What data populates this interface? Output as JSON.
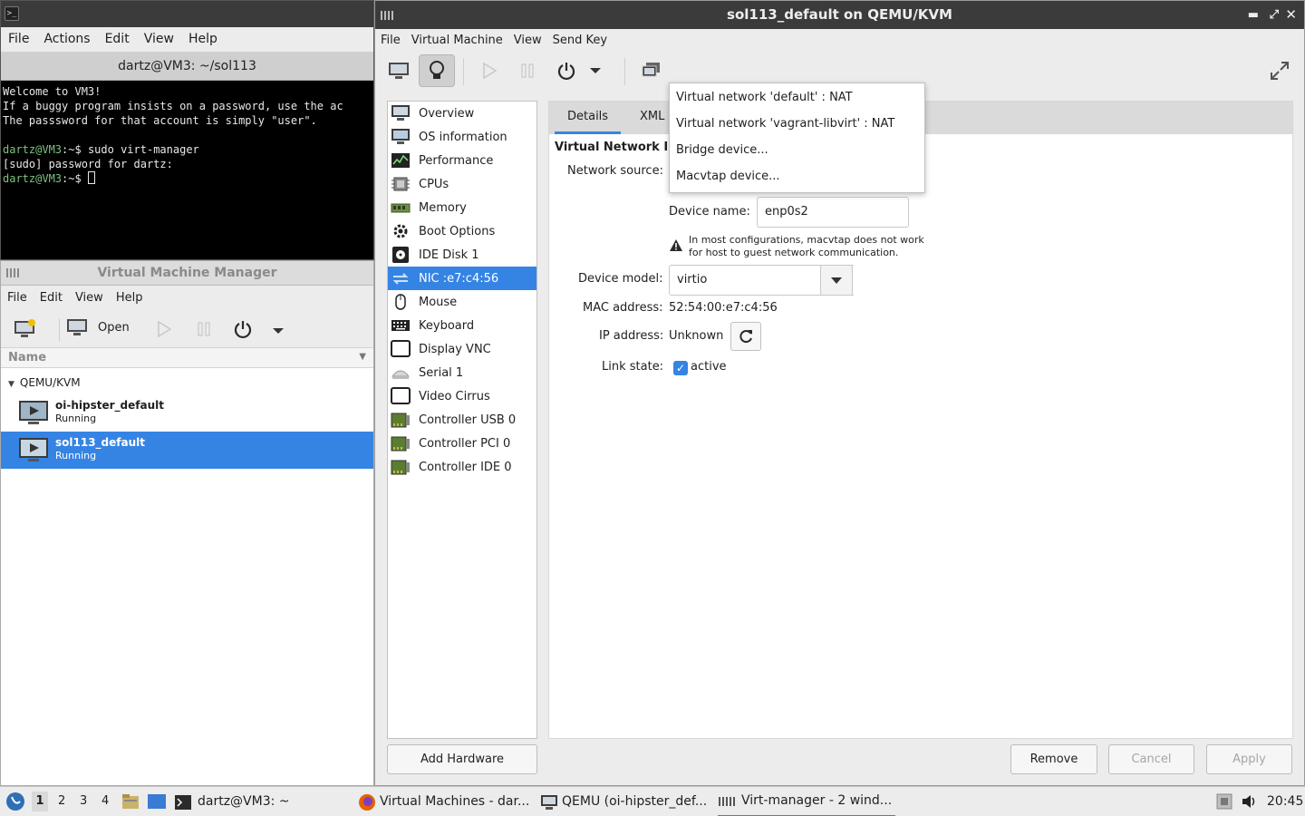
{
  "terminal": {
    "menu": [
      "File",
      "Actions",
      "Edit",
      "View",
      "Help"
    ],
    "tab_title": "dartz@VM3: ~/sol113",
    "line1": "Welcome to VM3!",
    "line2": "If a buggy program insists on a password, use the ac",
    "line3": "The passsword for that account is simply \"user\".",
    "prompt_user": "dartz@VM3",
    "prompt_path": ":~$",
    "command": " sudo virt-manager",
    "sudo_line": "[sudo] password for dartz:"
  },
  "vmm": {
    "title": "Virtual Machine Manager",
    "menu": [
      "File",
      "Edit",
      "View",
      "Help"
    ],
    "open_label": "Open",
    "column_name": "Name",
    "group": "QEMU/KVM",
    "vms": [
      {
        "name": "oi-hipster_default",
        "state": "Running"
      },
      {
        "name": "sol113_default",
        "state": "Running"
      }
    ]
  },
  "details": {
    "title": "sol113_default on QEMU/KVM",
    "menu": [
      "File",
      "Virtual Machine",
      "View",
      "Send Key"
    ],
    "hardware": [
      "Overview",
      "OS information",
      "Performance",
      "CPUs",
      "Memory",
      "Boot Options",
      "IDE Disk 1",
      "NIC :e7:c4:56",
      "Mouse",
      "Keyboard",
      "Display VNC",
      "Serial 1",
      "Video Cirrus",
      "Controller USB 0",
      "Controller PCI 0",
      "Controller IDE 0"
    ],
    "add_hardware": "Add Hardware",
    "tabs": [
      "Details",
      "XML"
    ],
    "section_title": "Virtual Network I",
    "network_source_label": "Network source:",
    "device_name_label": "Device name:",
    "device_name_value": "enp0s2",
    "warning_line1": "In most configurations, macvtap does not work",
    "warning_line2": "for host to guest network communication.",
    "device_model_label": "Device model:",
    "device_model_value": "virtio",
    "mac_label": "MAC address:",
    "mac_value": "52:54:00:e7:c4:56",
    "ip_label": "IP address:",
    "ip_value": "Unknown",
    "link_label": "Link state:",
    "link_value": "active",
    "remove": "Remove",
    "cancel": "Cancel",
    "apply": "Apply",
    "network_options": [
      "Virtual network 'default' : NAT",
      "Virtual network 'vagrant-libvirt' : NAT",
      "Bridge device...",
      "Macvtap device..."
    ]
  },
  "taskbar": {
    "workspaces": [
      "1",
      "2",
      "3",
      "4"
    ],
    "tasks": [
      "dartz@VM3: ~",
      "Virtual Machines - dar...",
      "QEMU (oi-hipster_def...",
      "Virt-manager - 2 wind..."
    ],
    "clock": "20:45"
  },
  "colors": {
    "accent": "#3584e4",
    "titlebar": "#3b3b3b",
    "terminal_bg": "#000000"
  }
}
